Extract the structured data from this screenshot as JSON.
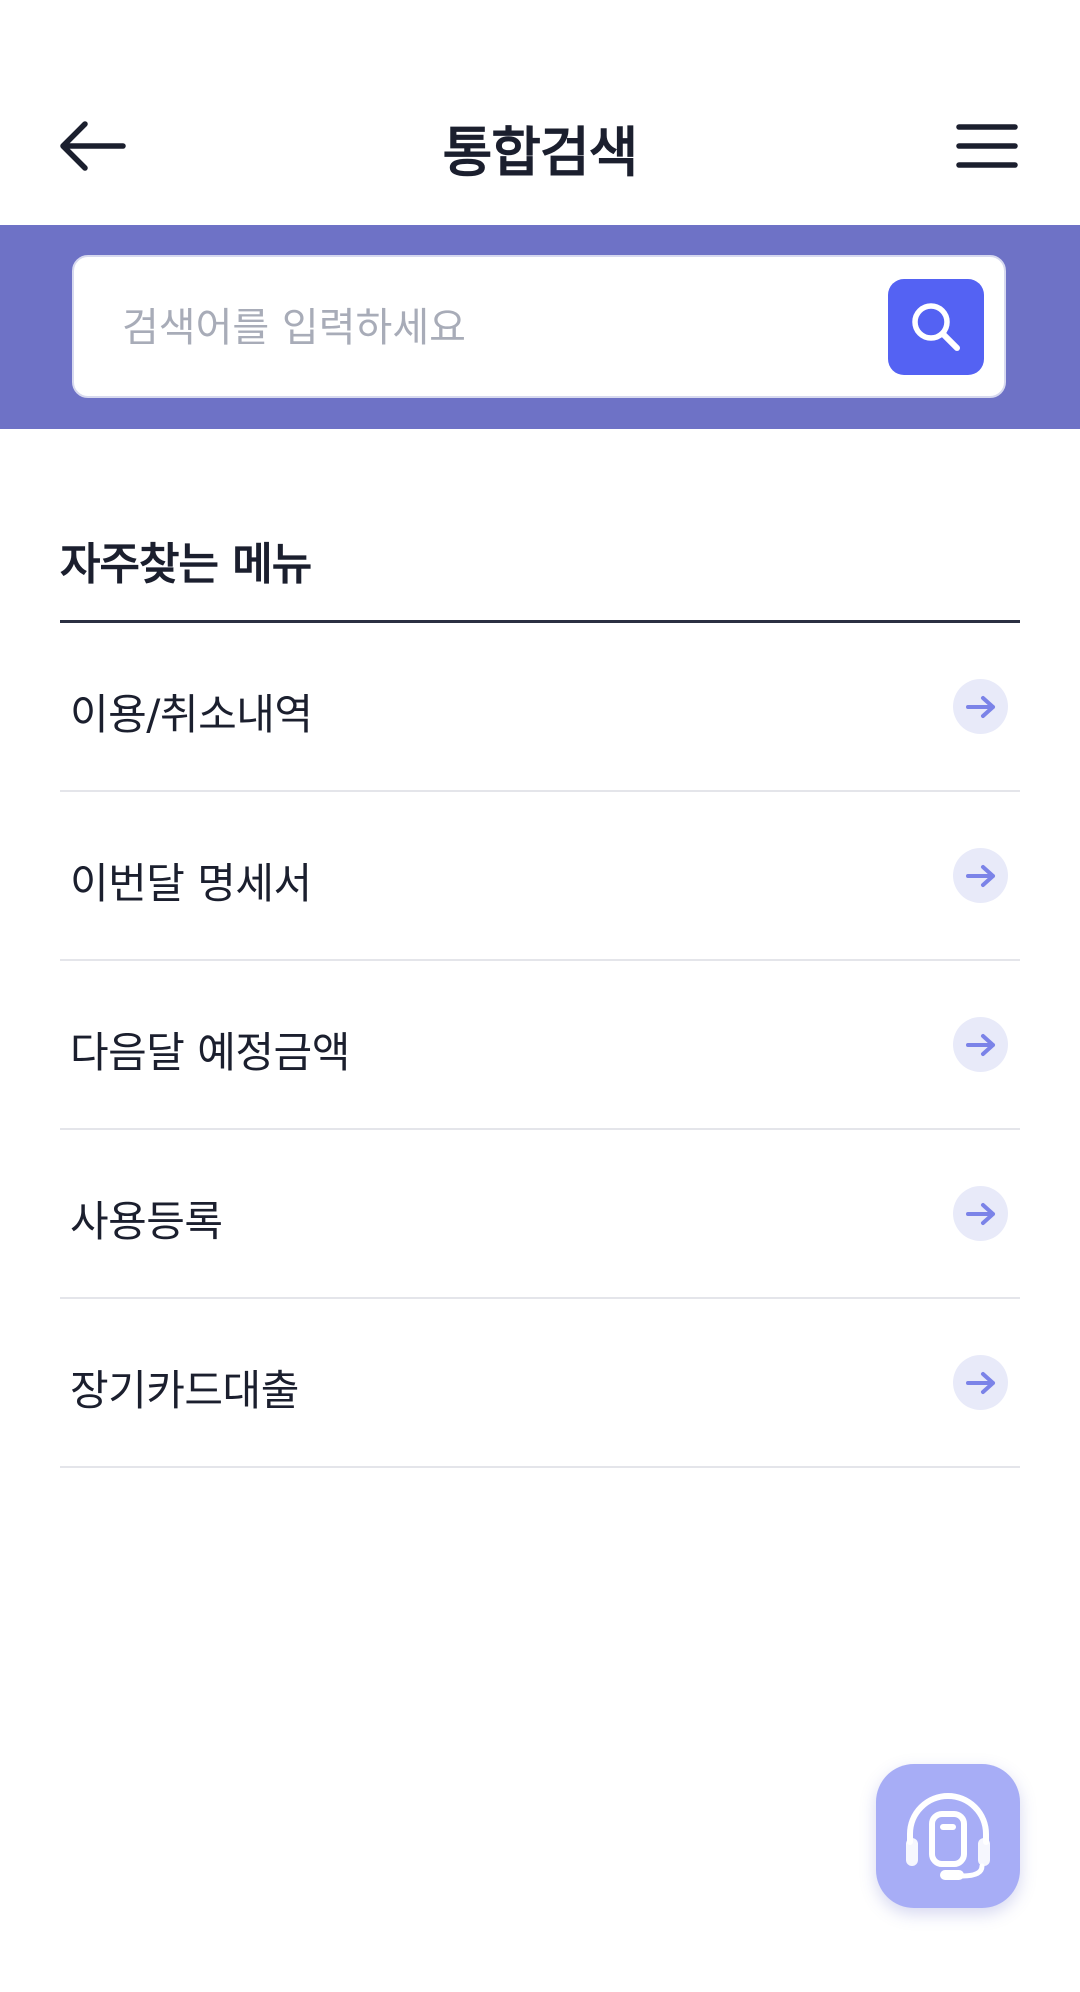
{
  "header": {
    "title": "통합검색",
    "back_icon": "arrow-left-icon",
    "menu_icon": "hamburger-menu-icon"
  },
  "search": {
    "placeholder": "검색어를 입력하세요",
    "value": "",
    "button_icon": "search-icon"
  },
  "section": {
    "title": "자주찾는 메뉴"
  },
  "menu_items": [
    {
      "label": "이용/취소내역",
      "icon": "arrow-right-icon"
    },
    {
      "label": "이번달 명세서",
      "icon": "arrow-right-icon"
    },
    {
      "label": "다음달 예정금액",
      "icon": "arrow-right-icon"
    },
    {
      "label": "사용등록",
      "icon": "arrow-right-icon"
    },
    {
      "label": "장기카드대출",
      "icon": "arrow-right-icon"
    }
  ],
  "floating_button": {
    "icon": "chatbot-headset-icon"
  },
  "colors": {
    "search_band": "#6e72c6",
    "search_button": "#5462f3",
    "arrow": "#7b83e8",
    "arrow_bg": "#e8eaf9",
    "chatbot_bg": "#a7adf6",
    "text": "#1b1f2e"
  }
}
